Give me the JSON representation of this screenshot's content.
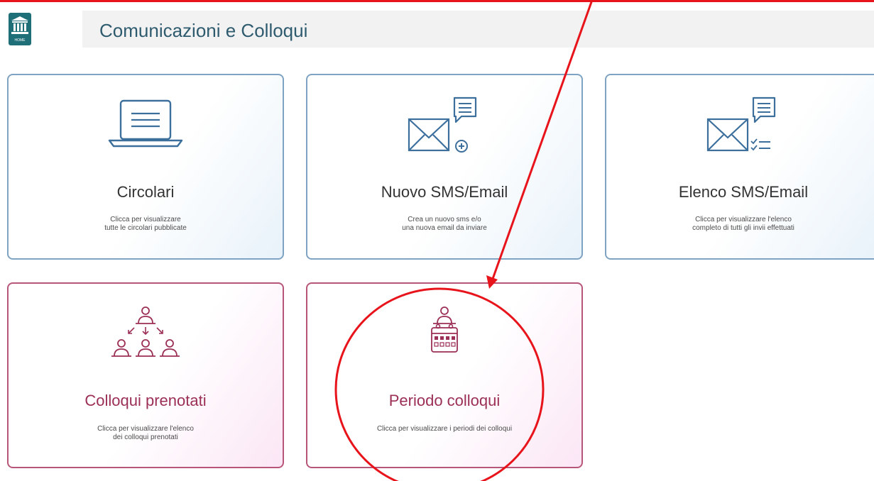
{
  "header": {
    "home_label": "HOME",
    "title": "Comunicazioni e Colloqui"
  },
  "cards": [
    {
      "title": "Circolari",
      "desc": "Clicca per visualizzare\ntutte le circolari pubblicate",
      "icon": "laptop-icon",
      "theme": "blue"
    },
    {
      "title": "Nuovo SMS/Email",
      "desc": "Crea un nuovo sms e/o\nuna nuova email da inviare",
      "icon": "new-message-icon",
      "theme": "blue"
    },
    {
      "title": "Elenco SMS/Email",
      "desc": "Clicca per visualizzare l'elenco\ncompleto di tutti gli invii effettuati",
      "icon": "message-list-icon",
      "theme": "blue"
    },
    {
      "title": "Colloqui prenotati",
      "desc": "Clicca per visualizzare l'elenco\ndei colloqui prenotati",
      "icon": "meeting-hierarchy-icon",
      "theme": "pink"
    },
    {
      "title": "Periodo colloqui",
      "desc": "Clicca per visualizzare i periodi dei colloqui",
      "icon": "meeting-calendar-icon",
      "theme": "pink"
    }
  ],
  "colors": {
    "header_text": "#2f5b6f",
    "blue_border": "#7fa3c2",
    "pink_border": "#b85679",
    "pink_title": "#9b2f55",
    "annotation_red": "#e8141b"
  }
}
